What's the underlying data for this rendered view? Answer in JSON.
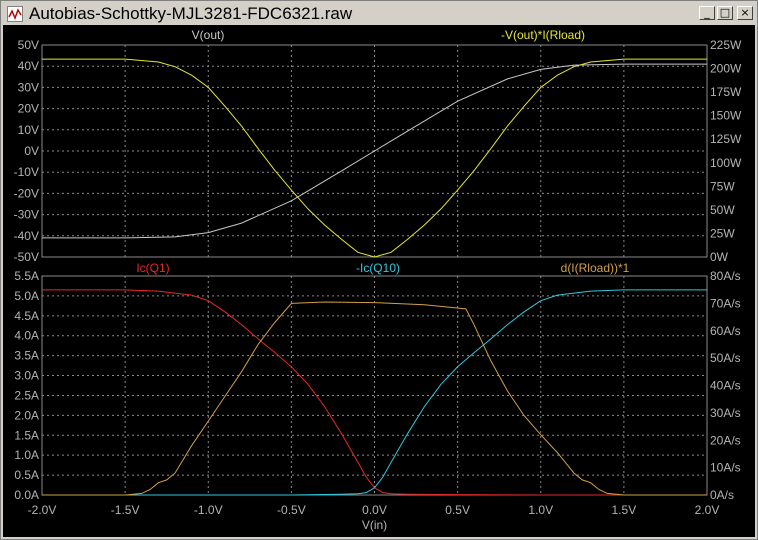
{
  "window": {
    "title": "Autobias-Schottky-MJL3281-FDC6321.raw",
    "app_icon": "waveform-icon",
    "buttons": {
      "minimize": "_",
      "maximize": "□",
      "close": "×"
    },
    "colors": {
      "background": "#000000",
      "grid": "#8a8a8a",
      "axis_text": "#b4b4b4"
    }
  },
  "chart_data": [
    {
      "type": "line",
      "xlabel": "V(in)",
      "xlim": [
        -2.0,
        2.0
      ],
      "x_ticks": [
        "-2.0V",
        "-1.5V",
        "-1.0V",
        "-0.5V",
        "0.0V",
        "0.5V",
        "1.0V",
        "1.5V",
        "2.0V"
      ],
      "ylim_left": [
        -50,
        50
      ],
      "ylim_right": [
        0,
        225
      ],
      "y_ticks_left": [
        "50V",
        "40V",
        "30V",
        "20V",
        "10V",
        "0V",
        "-10V",
        "-20V",
        "-30V",
        "-40V",
        "-50V"
      ],
      "y_ticks_right": [
        "225W",
        "200W",
        "175W",
        "150W",
        "125W",
        "100W",
        "75W",
        "50W",
        "25W",
        "0W"
      ],
      "grid": true,
      "series": [
        {
          "name": "V(out)",
          "color": "#c8c8c8",
          "axis": "left",
          "x": [
            -2.0,
            -1.5,
            -1.2,
            -1.0,
            -0.8,
            -0.5,
            -0.2,
            0.0,
            0.2,
            0.5,
            0.8,
            1.0,
            1.2,
            1.5,
            2.0
          ],
          "y": [
            -41,
            -41,
            -40.5,
            -38.5,
            -34,
            -23.5,
            -9.5,
            0,
            9.5,
            23.5,
            34,
            38.5,
            40.5,
            41,
            41
          ]
        },
        {
          "name": "-V(out)*I(Rload)",
          "color": "#e6e632",
          "axis": "right",
          "x": [
            -2.0,
            -1.5,
            -1.3,
            -1.2,
            -1.1,
            -1.0,
            -0.9,
            -0.8,
            -0.7,
            -0.6,
            -0.5,
            -0.4,
            -0.3,
            -0.2,
            -0.1,
            0.0,
            0.1,
            0.2,
            0.3,
            0.4,
            0.5,
            0.6,
            0.7,
            0.8,
            0.9,
            1.0,
            1.1,
            1.2,
            1.3,
            1.5,
            2.0
          ],
          "y": [
            210,
            210,
            207,
            202,
            193,
            180,
            160,
            139,
            115,
            92,
            71,
            51,
            34,
            19,
            5,
            0,
            5,
            19,
            34,
            51,
            71,
            92,
            115,
            139,
            160,
            180,
            193,
            202,
            207,
            210,
            210
          ]
        }
      ]
    },
    {
      "type": "line",
      "xlabel": "V(in)",
      "xlim": [
        -2.0,
        2.0
      ],
      "x_ticks": [
        "-2.0V",
        "-1.5V",
        "-1.0V",
        "-0.5V",
        "0.0V",
        "0.5V",
        "1.0V",
        "1.5V",
        "2.0V"
      ],
      "ylim_left": [
        0,
        5.5
      ],
      "ylim_right": [
        0,
        80
      ],
      "y_ticks_left": [
        "5.5A",
        "5.0A",
        "4.5A",
        "4.0A",
        "3.5A",
        "3.0A",
        "2.5A",
        "2.0A",
        "1.5A",
        "1.0A",
        "0.5A",
        "0.0A"
      ],
      "y_ticks_right": [
        "80A/s",
        "70A/s",
        "60A/s",
        "50A/s",
        "40A/s",
        "30A/s",
        "20A/s",
        "10A/s",
        "0A/s"
      ],
      "grid": true,
      "series": [
        {
          "name": "Ic(Q1)",
          "color": "#e62828",
          "axis": "left",
          "x": [
            -2.0,
            -1.5,
            -1.3,
            -1.1,
            -1.0,
            -0.9,
            -0.8,
            -0.7,
            -0.6,
            -0.5,
            -0.4,
            -0.3,
            -0.2,
            -0.1,
            -0.05,
            0.0,
            0.05,
            0.1,
            0.2,
            0.5,
            1.0,
            2.0
          ],
          "y": [
            5.15,
            5.15,
            5.12,
            5.02,
            4.88,
            4.6,
            4.28,
            3.92,
            3.58,
            3.22,
            2.78,
            2.22,
            1.55,
            0.82,
            0.45,
            0.18,
            0.06,
            0.03,
            0.02,
            0.01,
            0.0,
            0.0
          ]
        },
        {
          "name": "-Ic(Q10)",
          "color": "#32c8dc",
          "axis": "left",
          "x": [
            -2.0,
            -0.5,
            -0.2,
            -0.1,
            -0.05,
            0.0,
            0.05,
            0.1,
            0.2,
            0.3,
            0.4,
            0.5,
            0.6,
            0.7,
            0.8,
            0.9,
            1.0,
            1.1,
            1.3,
            1.5,
            2.0
          ],
          "y": [
            0.0,
            0.0,
            0.02,
            0.03,
            0.06,
            0.18,
            0.45,
            0.82,
            1.55,
            2.22,
            2.78,
            3.22,
            3.58,
            3.92,
            4.28,
            4.6,
            4.88,
            5.02,
            5.12,
            5.15,
            5.15
          ]
        },
        {
          "name": "d(I(Rload))*1",
          "color": "#d2a046",
          "axis": "right",
          "x": [
            -2.0,
            -1.5,
            -1.4,
            -1.35,
            -1.3,
            -1.25,
            -1.2,
            -1.1,
            -1.0,
            -0.9,
            -0.8,
            -0.7,
            -0.6,
            -0.5,
            -0.3,
            0.0,
            0.3,
            0.55,
            0.6,
            0.7,
            0.8,
            0.9,
            1.0,
            1.1,
            1.2,
            1.25,
            1.3,
            1.35,
            1.4,
            1.5,
            2.0
          ],
          "y": [
            0,
            0,
            0.6,
            2,
            4.5,
            5.5,
            8,
            18,
            27,
            36,
            45,
            55,
            63,
            70,
            70.5,
            70.3,
            69.5,
            68,
            62,
            49,
            38,
            29,
            22,
            15.5,
            8,
            5.5,
            4.5,
            2,
            0.6,
            0,
            0
          ]
        }
      ]
    }
  ]
}
